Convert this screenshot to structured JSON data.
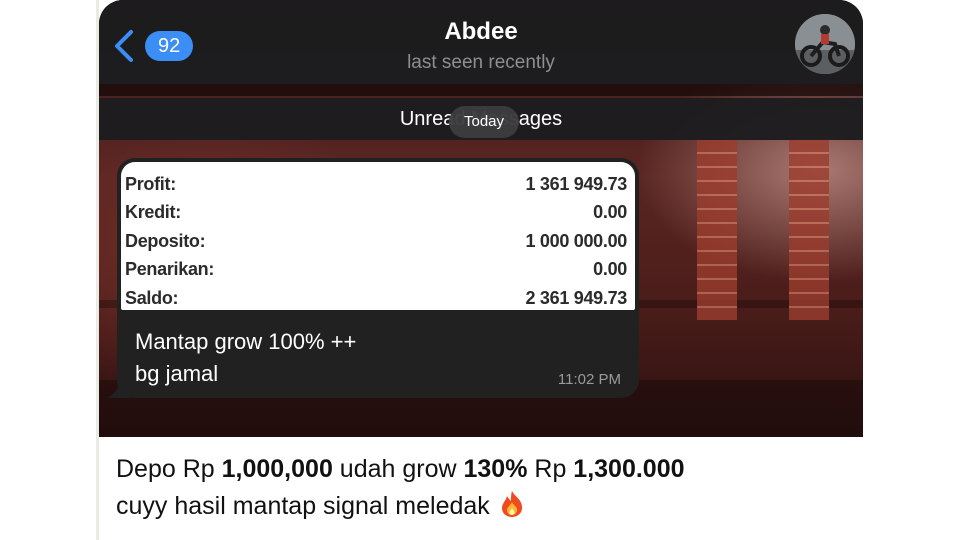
{
  "header": {
    "back_count": "92",
    "contact_name": "Abdee",
    "status": "last seen recently"
  },
  "chat": {
    "unread_label": "Unread Messages",
    "date_pill": "Today",
    "message": {
      "screenshot_rows": [
        {
          "label": "Profit:",
          "value": "1 361 949.73"
        },
        {
          "label": "Kredit:",
          "value": "0.00"
        },
        {
          "label": "Deposito:",
          "value": "1 000 000.00"
        },
        {
          "label": "Penarikan:",
          "value": "0.00"
        },
        {
          "label": "Saldo:",
          "value": "2 361 949.73"
        }
      ],
      "text_line1": "Mantap grow 100% ++",
      "text_line2": "bg jamal",
      "time": "11:02 PM"
    }
  },
  "post": {
    "p1": "Depo Rp ",
    "b1": "1,000,000",
    "p2": " udah grow ",
    "b2": "130%",
    "p3": " Rp ",
    "b3": "1,300.000",
    "line2": "cuyy hasil mantap signal meledak ",
    "emoji_icon": "fire-icon"
  },
  "colors": {
    "accent": "#3a8ef6",
    "header_bg": "#1c1c1e",
    "bubble_bg": "#212121"
  }
}
